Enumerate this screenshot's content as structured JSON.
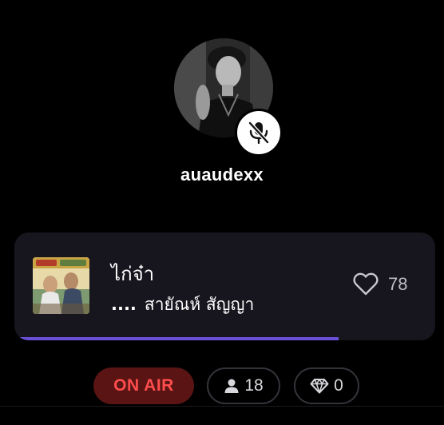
{
  "host": {
    "username": "auaudexx",
    "mic_status": "muted"
  },
  "now_playing": {
    "title": "ไก่จ๋า",
    "artist_prefix": "....",
    "artist": "สายัณห์ สัญญา",
    "likes": "78",
    "progress_percent": 77
  },
  "status": {
    "on_air_label": "ON AIR",
    "listeners": "18",
    "gems": "0"
  },
  "colors": {
    "background": "#000000",
    "card": "#17151d",
    "progress": "#6b4fd8",
    "on_air_bg": "#5a1414",
    "on_air_text": "#ff4d4d"
  },
  "icons": {
    "mic": "mic-off-icon",
    "like": "heart-outline-icon",
    "listeners": "person-icon",
    "gems": "diamond-icon"
  }
}
